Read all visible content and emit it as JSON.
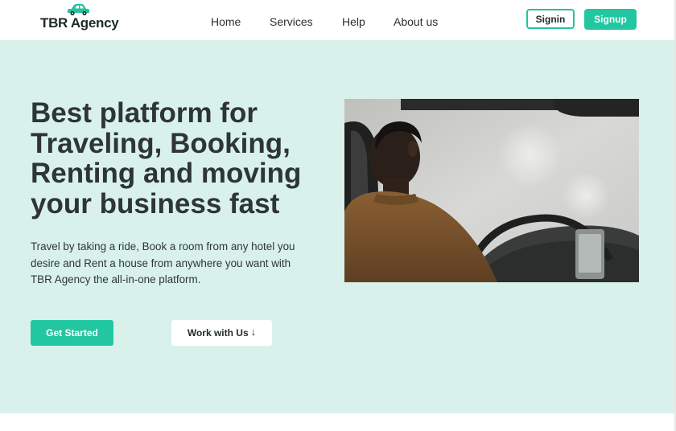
{
  "brand": {
    "name": "TBR Agency",
    "accent_color": "#22c7a1",
    "logo_icon": "car-icon"
  },
  "nav": {
    "items": [
      {
        "label": "Home"
      },
      {
        "label": "Services"
      },
      {
        "label": "Help"
      },
      {
        "label": "About us"
      }
    ]
  },
  "auth": {
    "signin_label": "Signin",
    "signup_label": "Signup"
  },
  "hero": {
    "background_color": "#d8f2eb",
    "title_lines": [
      "Best platform for",
      "Traveling, Booking,",
      "Renting and moving",
      "your business fast"
    ],
    "description_lines": [
      "Travel by taking a ride, Book a room from any hotel you",
      "desire and Rent a house from anywhere you want with",
      "TBR Agency the all-in-one platform."
    ],
    "primary_cta": "Get Started",
    "secondary_cta": "Work with Us",
    "secondary_cta_icon": "arrow-down-icon",
    "image_subject": "driver-in-car-photo"
  }
}
